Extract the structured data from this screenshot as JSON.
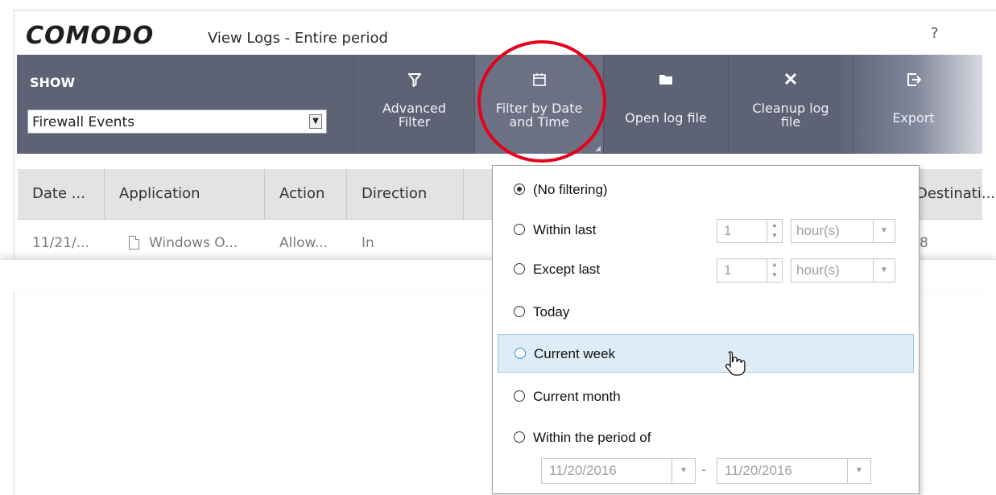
{
  "brand": "COMODO",
  "window_title": "View Logs - Entire period",
  "help_label": "?",
  "toolbar": {
    "show_label": "SHOW",
    "show_value": "Firewall Events",
    "buttons": [
      {
        "label_line1": "Advanced",
        "label_line2": "Filter"
      },
      {
        "label_line1": "Filter by Date",
        "label_line2": "and Time"
      },
      {
        "label": "Open log file"
      },
      {
        "label_line1": "Cleanup log",
        "label_line2": "file"
      },
      {
        "label": "Export"
      }
    ]
  },
  "table": {
    "columns": [
      "Date ...",
      "Application",
      "Action",
      "Direction",
      "Destinati..."
    ],
    "rows": [
      {
        "date": "11/21/...",
        "application": "Windows O...",
        "action": "Allow...",
        "direction": "In",
        "destination": "8"
      }
    ]
  },
  "filter_menu": {
    "options": [
      {
        "label": "(No filtering)",
        "selected": true
      },
      {
        "label": "Within last",
        "selected": false
      },
      {
        "label": "Except last",
        "selected": false
      },
      {
        "label": "Today",
        "selected": false
      },
      {
        "label": "Current week",
        "selected": false,
        "hovered": true
      },
      {
        "label": "Current month",
        "selected": false
      },
      {
        "label": "Within the period of",
        "selected": false
      }
    ],
    "within_last": {
      "value": "1",
      "unit": "hour(s)"
    },
    "except_last": {
      "value": "1",
      "unit": "hour(s)"
    },
    "period": {
      "from": "11/20/2016",
      "separator": "-",
      "to": "11/20/2016"
    }
  },
  "colors": {
    "toolbar": "#5d6375",
    "highlight_ring": "#e5001c",
    "hover_row": "#deecf7"
  }
}
